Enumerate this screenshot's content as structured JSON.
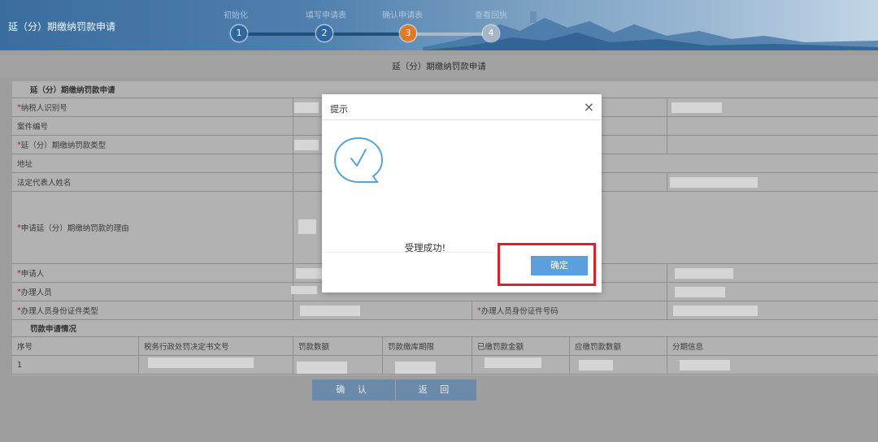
{
  "header": {
    "title": "延（分）期缴纳罚款申请",
    "steps": [
      {
        "num": "1",
        "label": "初始化"
      },
      {
        "num": "2",
        "label": "填写申请表"
      },
      {
        "num": "3",
        "label": "确认申请表"
      },
      {
        "num": "4",
        "label": "查看回执"
      }
    ],
    "current_step": 3
  },
  "page_heading": "延（分）期缴纳罚款申请",
  "form": {
    "section1": "延（分）期缴纳罚款申请",
    "fields": {
      "taxpayer_id": "纳税人识别号",
      "case_no": "案件编号",
      "type": "延（分）期缴纳罚款类型",
      "address": "地址",
      "legal_rep": "法定代表人姓名",
      "reason": "申请延（分）期缴纳罚款的理由",
      "applicant": "申请人",
      "handler": "办理人员",
      "id_type": "办理人员身份证件类型",
      "id_no": "办理人员身份证件号码"
    },
    "required_mark": "*",
    "section2": "罚款申请情况",
    "columns": [
      "序号",
      "税务行政处罚决定书文号",
      "罚款数额",
      "罚款缴库期限",
      "已缴罚款金额",
      "应缴罚款数额",
      "分期信息"
    ],
    "rows": [
      {
        "seq": "1"
      }
    ]
  },
  "buttons": {
    "confirm": "确 认",
    "back": "返 回"
  },
  "modal": {
    "title": "提示",
    "close": "×",
    "message": "受理成功!",
    "ok": "确定"
  },
  "colors": {
    "header_blue": "#3a6d9e",
    "step_active": "#e07a28",
    "step_done": "#2f68a0",
    "ok_button": "#5b9fdc",
    "highlight": "#d9232a"
  }
}
